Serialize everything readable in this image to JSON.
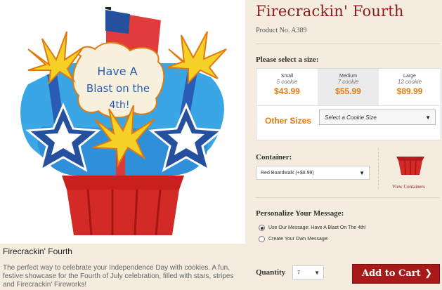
{
  "product": {
    "title": "Firecrackin' Fourth",
    "product_no": "Product No. A389",
    "caption_title": "Firecrackin' Fourth",
    "description": "The perfect way to celebrate your Independence Day with cookies. A fun, festive showcase for the Fourth of July celebration, filled with stars, stripes and Firecrackin' Fireworks!",
    "cookie_text": [
      "Have A",
      "Blast on the",
      "4th!"
    ]
  },
  "size": {
    "label": "Please select a size:",
    "options": [
      {
        "name": "Small",
        "count": "5 cookie",
        "price": "$43.99"
      },
      {
        "name": "Medium",
        "count": "7 cookie",
        "price": "$55.99"
      },
      {
        "name": "Large",
        "count": "12 cookie",
        "price": "$89.99"
      }
    ],
    "selected_index": 1,
    "other_sizes_label": "Other Sizes",
    "cookie_size_placeholder": "Select a Cookie Size"
  },
  "container": {
    "label": "Container:",
    "selected": "Red Boardwalk (+$8.99)",
    "view_link": "View Containers"
  },
  "personalize": {
    "label": "Personalize Your Message:",
    "options": [
      {
        "label": "Use Our Message: Have A Blast On The 4th!",
        "checked": true
      },
      {
        "label": "Create Your Own Message:",
        "checked": false
      }
    ]
  },
  "quantity": {
    "label": "Quantity",
    "value": "7"
  },
  "cart": {
    "label": "Add to Cart"
  },
  "colors": {
    "brand_red": "#a81a1a",
    "price_orange": "#e07a10"
  }
}
